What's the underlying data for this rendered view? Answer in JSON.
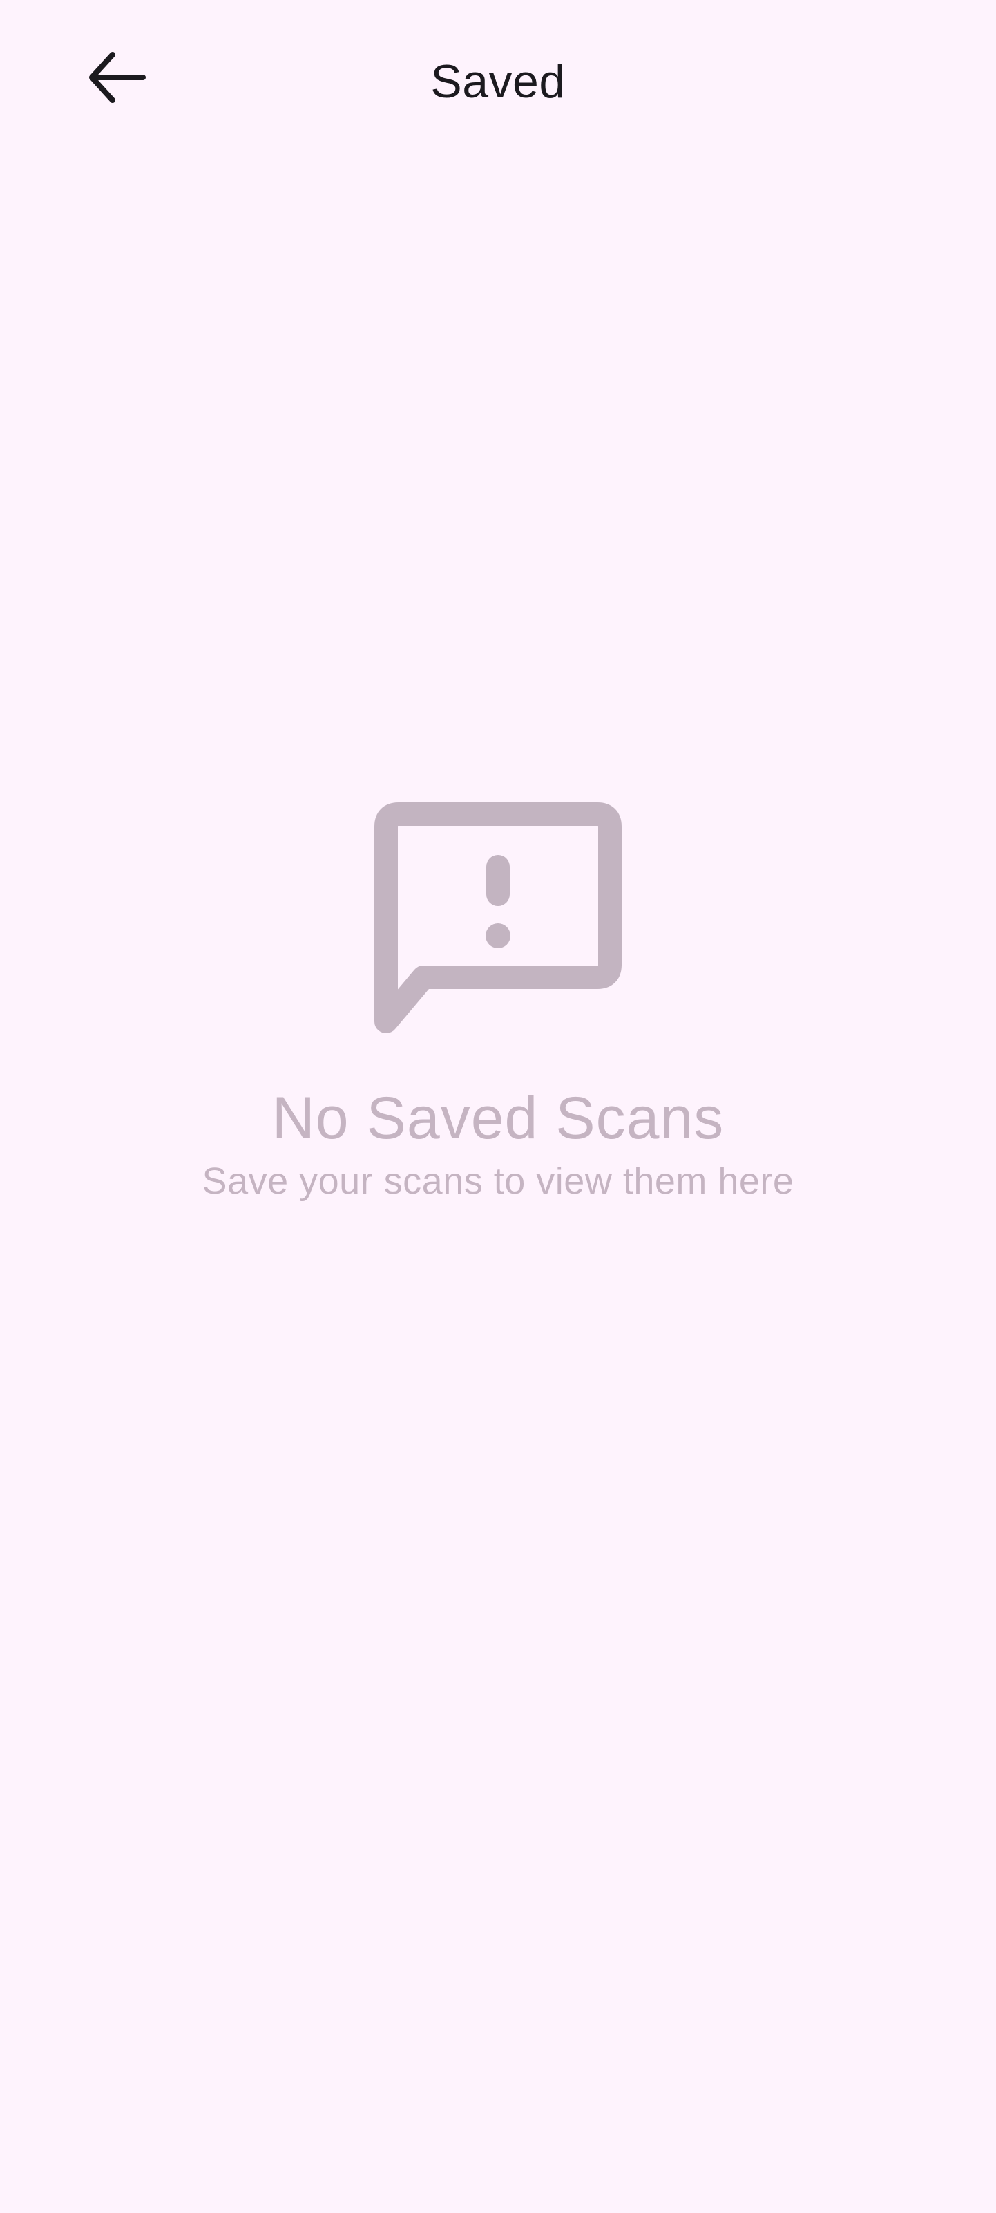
{
  "header": {
    "title": "Saved",
    "back_icon": "arrow-left-icon"
  },
  "empty_state": {
    "icon": "message-alert-icon",
    "title": "No Saved Scans",
    "subtitle": "Save your scans to view them here"
  },
  "colors": {
    "background": "#FEF3FD",
    "title_text": "#1C1A1F",
    "muted": "#C5B4C2"
  }
}
